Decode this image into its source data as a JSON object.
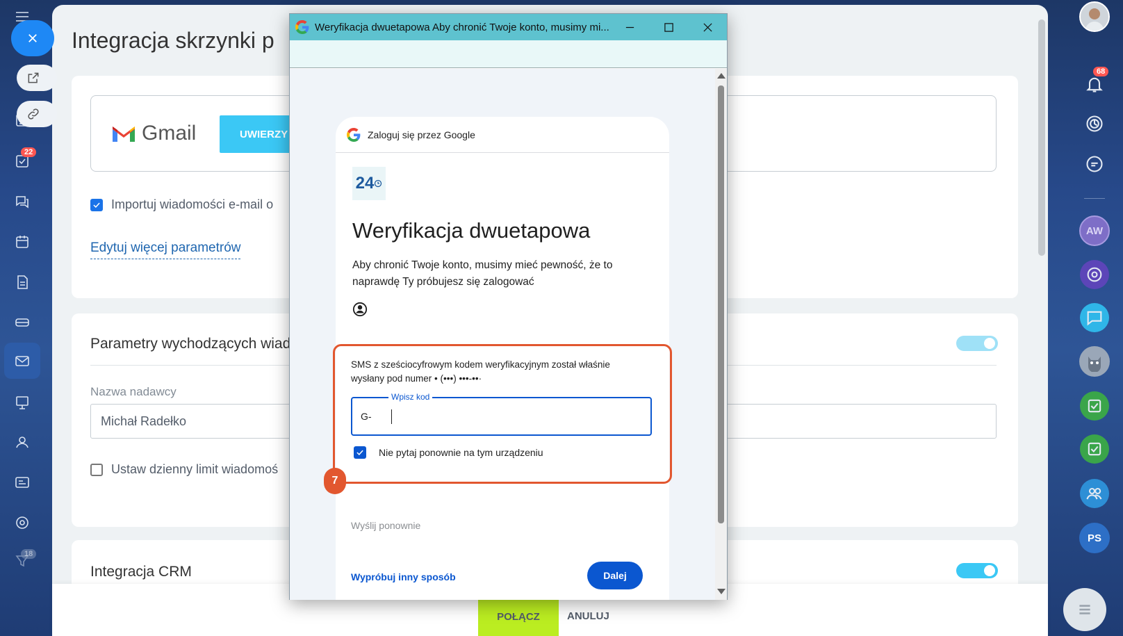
{
  "left_nav": {
    "tasks_badge": "22",
    "faded_badge": "18"
  },
  "page": {
    "title": "Integracja skrzynki p",
    "gmail_brand": "Gmail",
    "auth_button": "UWIERZY",
    "import_label": "Importuj wiadomości e-mail o",
    "edit_more_link": "Edytuj więcej parametrów",
    "outgoing_section": "Parametry wychodzących wiad",
    "sender_label": "Nazwa nadawcy",
    "sender_value": "Michał Radełko",
    "daily_limit_label": "Ustaw dzienny limit wiadomoś",
    "crm_section": "Integracja CRM",
    "connect_button": "POŁĄCZ",
    "cancel_button": "ANULUJ"
  },
  "right_nav": {
    "notif_badge": "68",
    "avatars": [
      "AW",
      "PS"
    ]
  },
  "popup": {
    "window_title": "Weryfikacja dwuetapowa Aby chronić Twoje konto, musimy mi...",
    "signin_header": "Zaloguj się przez Google",
    "logo_text": "24",
    "heading": "Weryfikacja dwuetapowa",
    "description": "Aby chronić Twoje konto, musimy mieć pewność, że to naprawdę Ty próbujesz się zalogować",
    "sms_info": "SMS z sześciocyfrowym kodem weryfikacyjnym został właśnie wysłany pod numer • (•••) •••-••·",
    "code_label": "Wpisz kod",
    "code_prefix": "G-",
    "remember_label": "Nie pytaj ponownie na tym urządzeniu",
    "step_number": "7",
    "resend": "Wyślij ponownie",
    "try_other": "Wypróbuj inny sposób",
    "next_button": "Dalej"
  },
  "colors": {
    "accent_blue": "#3bc8f5",
    "google_blue": "#0b57d0",
    "highlight_red": "#e2572f",
    "connect_green": "#bbed21"
  }
}
